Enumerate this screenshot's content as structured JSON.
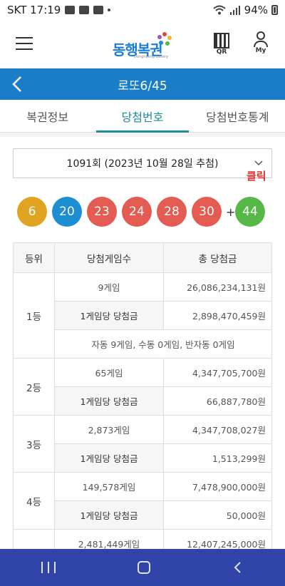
{
  "status_bar": {
    "carrier_time": "SKT 17:19",
    "battery": "94%"
  },
  "header": {
    "logo_text": "동행복권",
    "logo_sub": "Donghaeng Lottery",
    "qr_label": "QR",
    "my_label": "My"
  },
  "title_bar": {
    "title": "로또6/45"
  },
  "tabs": [
    {
      "label": "복권정보",
      "active": false
    },
    {
      "label": "당첨번호",
      "active": true
    },
    {
      "label": "당첨번호통계",
      "active": false
    }
  ],
  "draw_select": {
    "value": "1091회 (2023년 10월 28일 추첨)"
  },
  "annotation": {
    "click_label": "클릭"
  },
  "winning_numbers": {
    "main": [
      {
        "n": "6",
        "color": "#e0a422"
      },
      {
        "n": "20",
        "color": "#1e8ed3"
      },
      {
        "n": "23",
        "color": "#e35b51"
      },
      {
        "n": "24",
        "color": "#e35b51"
      },
      {
        "n": "28",
        "color": "#e35b51"
      },
      {
        "n": "30",
        "color": "#e35b51"
      }
    ],
    "plus": "+",
    "bonus": {
      "n": "44",
      "color": "#55b847"
    }
  },
  "table": {
    "headers": [
      "등위",
      "당첨게임수",
      "총 당첨금"
    ],
    "rank1": {
      "rank": "1등",
      "games": "9게임",
      "total": "26,086,234,131원",
      "per_label": "1게임당 당첨금",
      "per_amount": "2,898,470,459원",
      "note": "자동 9게임, 수동 0게임, 반자동 0게임"
    },
    "rank2": {
      "rank": "2등",
      "games": "65게임",
      "total": "4,347,705,700원",
      "per_label": "1게임당 당첨금",
      "per_amount": "66,887,780원"
    },
    "rank3": {
      "rank": "3등",
      "games": "2,873게임",
      "total": "4,347,708,027원",
      "per_label": "1게임당 당첨금",
      "per_amount": "1,513,299원"
    },
    "rank4": {
      "rank": "4등",
      "games": "149,578게임",
      "total": "7,478,900,000원",
      "per_label": "1게임당 당첨금",
      "per_amount": "50,000원"
    },
    "rank5": {
      "games": "2,481,449게임",
      "total": "12,407,245,000원"
    }
  },
  "colors": {
    "title_bar": "#1a7dc8",
    "active_tab": "#1e8c9a",
    "nav_bar": "#2f44a6",
    "click_label": "#e03030"
  }
}
